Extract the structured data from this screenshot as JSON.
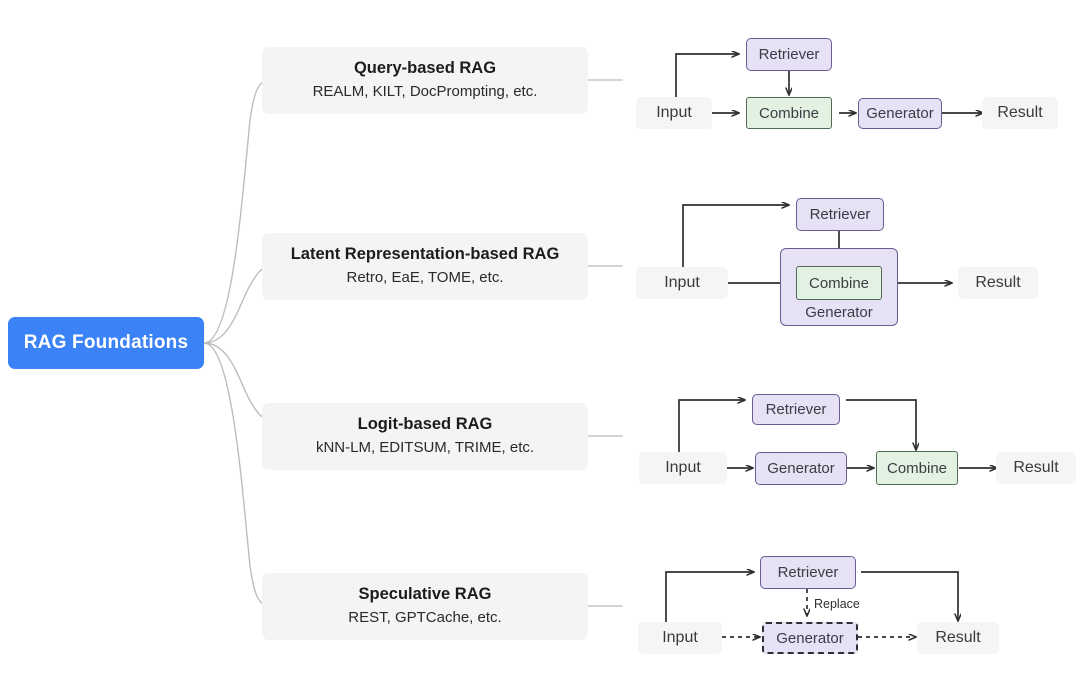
{
  "root": {
    "label": "RAG Foundations",
    "color": "#3b82f6",
    "text_color": "#ffffff"
  },
  "theme": {
    "background": "#ffffff",
    "topic_box_bg": "#f4f4f5",
    "branch_line": "#bdbdbd",
    "node_purple_fill": "#e6e1f5",
    "node_purple_border": "#6b5b95",
    "node_green_fill": "#e3f1e3",
    "node_green_border": "#4f6b52",
    "node_plain_fill": "#f5f5f6",
    "arrow_color": "#2f2f33"
  },
  "branches": [
    {
      "title": "Query-based RAG",
      "subtitle": "REALM, KILT, DocPrompting, etc.",
      "diagram": {
        "name": "query-based-rag-flow",
        "nodes": [
          {
            "id": "input",
            "label": "Input",
            "style": "plain"
          },
          {
            "id": "retriever",
            "label": "Retriever",
            "style": "purple"
          },
          {
            "id": "combine",
            "label": "Combine",
            "style": "green"
          },
          {
            "id": "generator",
            "label": "Generator",
            "style": "purple"
          },
          {
            "id": "result",
            "label": "Result",
            "style": "plain"
          }
        ],
        "edges": [
          {
            "from": "input",
            "to": "retriever",
            "style": "solid"
          },
          {
            "from": "input",
            "to": "combine",
            "style": "solid"
          },
          {
            "from": "retriever",
            "to": "combine",
            "style": "solid"
          },
          {
            "from": "combine",
            "to": "generator",
            "style": "solid"
          },
          {
            "from": "generator",
            "to": "result",
            "style": "solid"
          }
        ]
      }
    },
    {
      "title": "Latent Representation-based RAG",
      "subtitle": "Retro, EaE, TOME, etc.",
      "diagram": {
        "name": "latent-representation-based-rag-flow",
        "nodes": [
          {
            "id": "input",
            "label": "Input",
            "style": "plain"
          },
          {
            "id": "retriever",
            "label": "Retriever",
            "style": "purple"
          },
          {
            "id": "generator",
            "label": "Generator",
            "style": "group"
          },
          {
            "id": "combine",
            "label": "Combine",
            "style": "green"
          },
          {
            "id": "result",
            "label": "Result",
            "style": "plain"
          }
        ],
        "edges": [
          {
            "from": "input",
            "to": "retriever",
            "style": "solid"
          },
          {
            "from": "input",
            "to": "combine",
            "style": "solid"
          },
          {
            "from": "retriever",
            "to": "combine",
            "style": "solid"
          },
          {
            "from": "combine",
            "to": "result",
            "style": "solid"
          }
        ]
      }
    },
    {
      "title": "Logit-based RAG",
      "subtitle": "kNN-LM, EDITSUM, TRIME, etc.",
      "diagram": {
        "name": "logit-based-rag-flow",
        "nodes": [
          {
            "id": "input",
            "label": "Input",
            "style": "plain"
          },
          {
            "id": "retriever",
            "label": "Retriever",
            "style": "purple"
          },
          {
            "id": "generator",
            "label": "Generator",
            "style": "purple"
          },
          {
            "id": "combine",
            "label": "Combine",
            "style": "green"
          },
          {
            "id": "result",
            "label": "Result",
            "style": "plain"
          }
        ],
        "edges": [
          {
            "from": "input",
            "to": "retriever",
            "style": "solid"
          },
          {
            "from": "input",
            "to": "generator",
            "style": "solid"
          },
          {
            "from": "generator",
            "to": "combine",
            "style": "solid"
          },
          {
            "from": "retriever",
            "to": "combine",
            "style": "solid"
          },
          {
            "from": "combine",
            "to": "result",
            "style": "solid"
          }
        ]
      }
    },
    {
      "title": "Speculative RAG",
      "subtitle": "REST, GPTCache, etc.",
      "diagram": {
        "name": "speculative-rag-flow",
        "nodes": [
          {
            "id": "input",
            "label": "Input",
            "style": "plain"
          },
          {
            "id": "retriever",
            "label": "Retriever",
            "style": "purple"
          },
          {
            "id": "generator",
            "label": "Generator",
            "style": "dashed"
          },
          {
            "id": "result",
            "label": "Result",
            "style": "plain"
          }
        ],
        "edges": [
          {
            "from": "input",
            "to": "retriever",
            "style": "solid"
          },
          {
            "from": "input",
            "to": "generator",
            "style": "dashed"
          },
          {
            "from": "retriever",
            "to": "generator",
            "style": "dashed",
            "label": "Replace"
          },
          {
            "from": "retriever",
            "to": "result",
            "style": "solid"
          },
          {
            "from": "generator",
            "to": "result",
            "style": "dashed"
          }
        ]
      }
    }
  ]
}
